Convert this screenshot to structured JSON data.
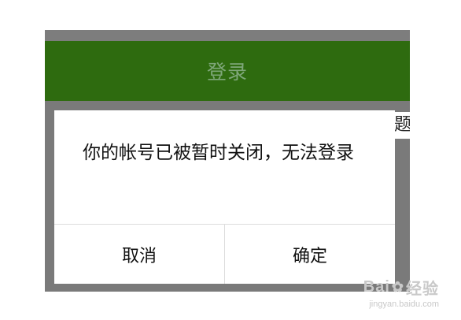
{
  "screen": {
    "title": "登录",
    "partial_text": "题"
  },
  "dialog": {
    "message": "你的帐号已被暂时关闭，无法登录",
    "cancel_label": "取消",
    "confirm_label": "确定"
  },
  "watermark": {
    "brand_left": "Bai",
    "brand_right": "经验",
    "url": "jingyan.baidu.com"
  },
  "colors": {
    "header_bg": "#2e6b0f",
    "overlay": "#7d7d7d",
    "dialog_bg": "#ffffff"
  }
}
